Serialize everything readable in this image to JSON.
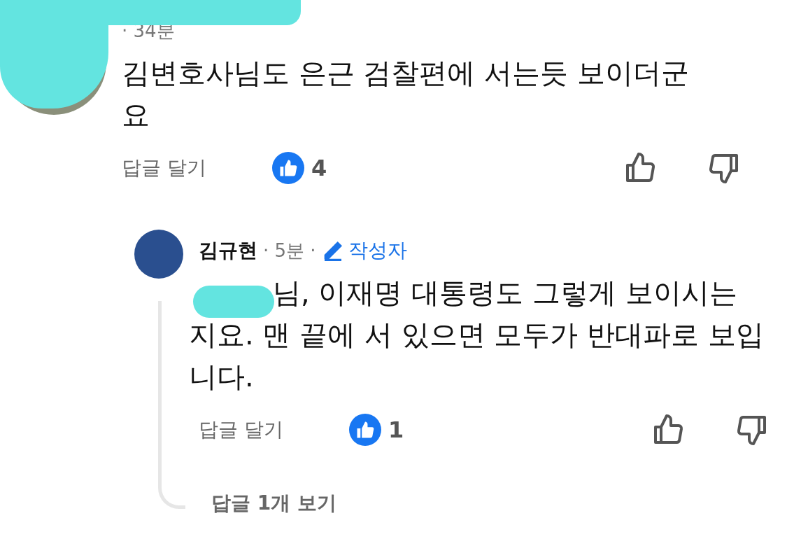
{
  "comment": {
    "redacted": true,
    "meta": "· 34분",
    "body": "김변호사님도 은근 검찰편에 서는듯 보이더군요",
    "reply_label": "답글 달기",
    "like_count": "4"
  },
  "reply": {
    "author": "김규현",
    "time": "· 5분 ·",
    "badge": "작성자",
    "mention_redacted": true,
    "body": "님, 이재명 대통령도 그렇게 보이시는지요. 맨 끝에 서 있으면 모두가 반대파로 보입니다.",
    "reply_label": "답글 달기",
    "like_count": "1"
  },
  "view_replies": "답글 1개 보기"
}
